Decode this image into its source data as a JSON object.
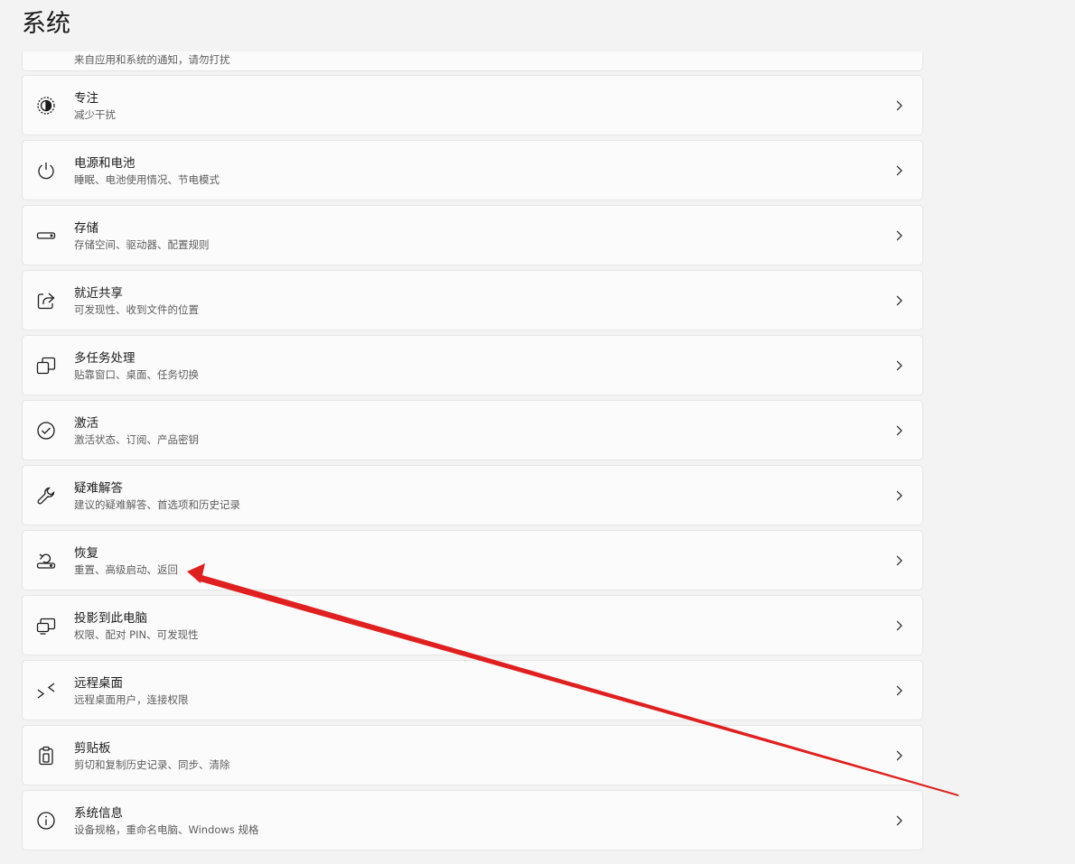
{
  "header": {
    "title": "系统"
  },
  "partial_item": {
    "subtitle": "来自应用和系统的通知，请勿打扰"
  },
  "items": [
    {
      "icon": "focus-icon",
      "title": "专注",
      "subtitle": "减少干扰"
    },
    {
      "icon": "power-icon",
      "title": "电源和电池",
      "subtitle": "睡眠、电池使用情况、节电模式"
    },
    {
      "icon": "storage-icon",
      "title": "存储",
      "subtitle": "存储空间、驱动器、配置规则"
    },
    {
      "icon": "share-icon",
      "title": "就近共享",
      "subtitle": "可发现性、收到文件的位置"
    },
    {
      "icon": "multitasking-icon",
      "title": "多任务处理",
      "subtitle": "贴靠窗口、桌面、任务切换"
    },
    {
      "icon": "activation-icon",
      "title": "激活",
      "subtitle": "激活状态、订阅、产品密钥"
    },
    {
      "icon": "wrench-icon",
      "title": "疑难解答",
      "subtitle": "建议的疑难解答、首选项和历史记录"
    },
    {
      "icon": "recovery-icon",
      "title": "恢复",
      "subtitle": "重置、高级启动、返回"
    },
    {
      "icon": "project-icon",
      "title": "投影到此电脑",
      "subtitle": "权限、配对 PIN、可发现性"
    },
    {
      "icon": "remote-desktop-icon",
      "title": "远程桌面",
      "subtitle": "远程桌面用户，连接权限"
    },
    {
      "icon": "clipboard-icon",
      "title": "剪贴板",
      "subtitle": "剪切和复制历史记录、同步、清除"
    },
    {
      "icon": "info-icon",
      "title": "系统信息",
      "subtitle": "设备规格，重命名电脑、Windows 规格"
    }
  ],
  "annotation": {
    "color": "#e02020",
    "points_to": "恢复"
  }
}
